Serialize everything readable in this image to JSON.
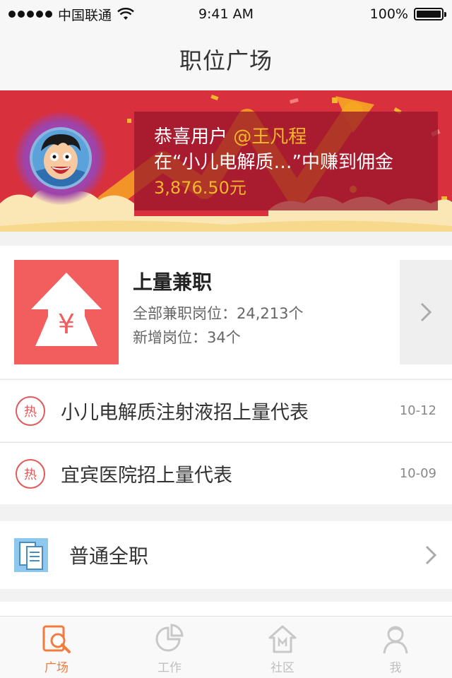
{
  "status_bar": {
    "carrier": "中国联通",
    "time": "9:41 AM",
    "battery": "100%"
  },
  "nav": {
    "title": "职位广场"
  },
  "banner": {
    "prefix": "恭喜用户 ",
    "user": "@王凡程",
    "line2": "在“小儿电解质…”中赚到佣金",
    "amount": "3,876.50元"
  },
  "card": {
    "title": "上量兼职",
    "total_label": "全部兼职岗位：24,213个",
    "new_label": "新增岗位：34个",
    "icon": "yen-arrow-up-icon"
  },
  "hot_list": [
    {
      "badge": "热",
      "title": "小儿电解质注射液招上量代表",
      "date": "10-12"
    },
    {
      "badge": "热",
      "title": "宜宾医院招上量代表",
      "date": "10-09"
    }
  ],
  "fulltime": {
    "label": "普通全职",
    "icon": "document-icon"
  },
  "tabs": [
    {
      "label": "广场",
      "icon": "search-doc-icon",
      "active": true
    },
    {
      "label": "工作",
      "icon": "pie-chart-icon",
      "active": false
    },
    {
      "label": "社区",
      "icon": "house-icon",
      "active": false
    },
    {
      "label": "我",
      "icon": "person-icon",
      "active": false
    }
  ],
  "colors": {
    "accent": "#f47b3e",
    "banner_red": "#d9303e",
    "hot_red": "#e25a5a",
    "card_icon_bg": "#f25d5d",
    "highlight_gold": "#f3b72c"
  }
}
